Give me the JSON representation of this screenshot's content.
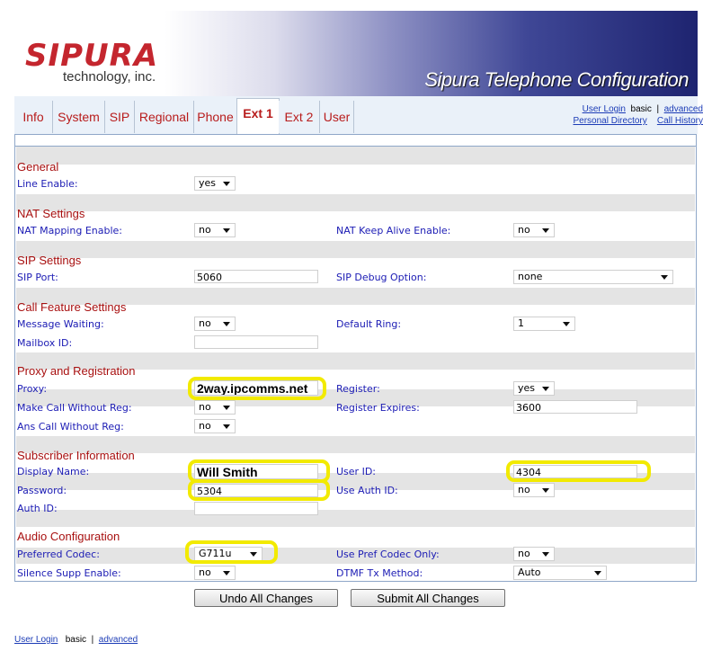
{
  "header": {
    "logo": "SIPURA",
    "logo_sub": "technology, inc.",
    "title": "Sipura Telephone Configuration"
  },
  "tabs": [
    {
      "label": "Info"
    },
    {
      "label": "System"
    },
    {
      "label": "SIP"
    },
    {
      "label": "Regional"
    },
    {
      "label": "Phone"
    },
    {
      "label": "Ext 1",
      "active": true
    },
    {
      "label": "Ext 2"
    },
    {
      "label": "User"
    }
  ],
  "top_links": {
    "user_login": "User Login",
    "basic": "basic",
    "sep": "|",
    "advanced": "advanced",
    "personal_directory": "Personal Directory",
    "call_history": "Call History"
  },
  "sections": {
    "general": {
      "title": "General",
      "line_enable_label": "Line Enable:",
      "line_enable_value": "yes"
    },
    "nat": {
      "title": "NAT Settings",
      "mapping_label": "NAT Mapping Enable:",
      "mapping_value": "no",
      "keepalive_label": "NAT Keep Alive Enable:",
      "keepalive_value": "no"
    },
    "sip": {
      "title": "SIP Settings",
      "port_label": "SIP Port:",
      "port_value": "5060",
      "debug_label": "SIP Debug Option:",
      "debug_value": "none"
    },
    "call_feature": {
      "title": "Call Feature Settings",
      "mwi_label": "Message Waiting:",
      "mwi_value": "no",
      "ring_label": "Default Ring:",
      "ring_value": "1",
      "mailbox_label": "Mailbox ID:",
      "mailbox_value": ""
    },
    "proxy": {
      "title": "Proxy and Registration",
      "proxy_label": "Proxy:",
      "proxy_value": "2way.ipcomms.net",
      "register_label": "Register:",
      "register_value": "yes",
      "make_call_label": "Make Call Without Reg:",
      "make_call_value": "no",
      "expires_label": "Register Expires:",
      "expires_value": "3600",
      "ans_call_label": "Ans Call Without Reg:",
      "ans_call_value": "no"
    },
    "subscriber": {
      "title": "Subscriber Information",
      "display_label": "Display Name:",
      "display_value": "Will Smith",
      "userid_label": "User ID:",
      "userid_value": "4304",
      "password_label": "Password:",
      "password_value": "5304",
      "useauth_label": "Use Auth ID:",
      "useauth_value": "no",
      "authid_label": "Auth ID:",
      "authid_value": ""
    },
    "audio": {
      "title": "Audio Configuration",
      "codec_label": "Preferred Codec:",
      "codec_value": "G711u",
      "usepref_label": "Use Pref Codec Only:",
      "usepref_value": "no",
      "silence_label": "Silence Supp Enable:",
      "silence_value": "no",
      "dtmf_label": "DTMF Tx Method:",
      "dtmf_value": "Auto"
    }
  },
  "buttons": {
    "undo": "Undo All Changes",
    "submit": "Submit All Changes"
  },
  "footer": {
    "user_login": "User Login",
    "basic": "basic",
    "sep": "|",
    "advanced": "advanced"
  }
}
